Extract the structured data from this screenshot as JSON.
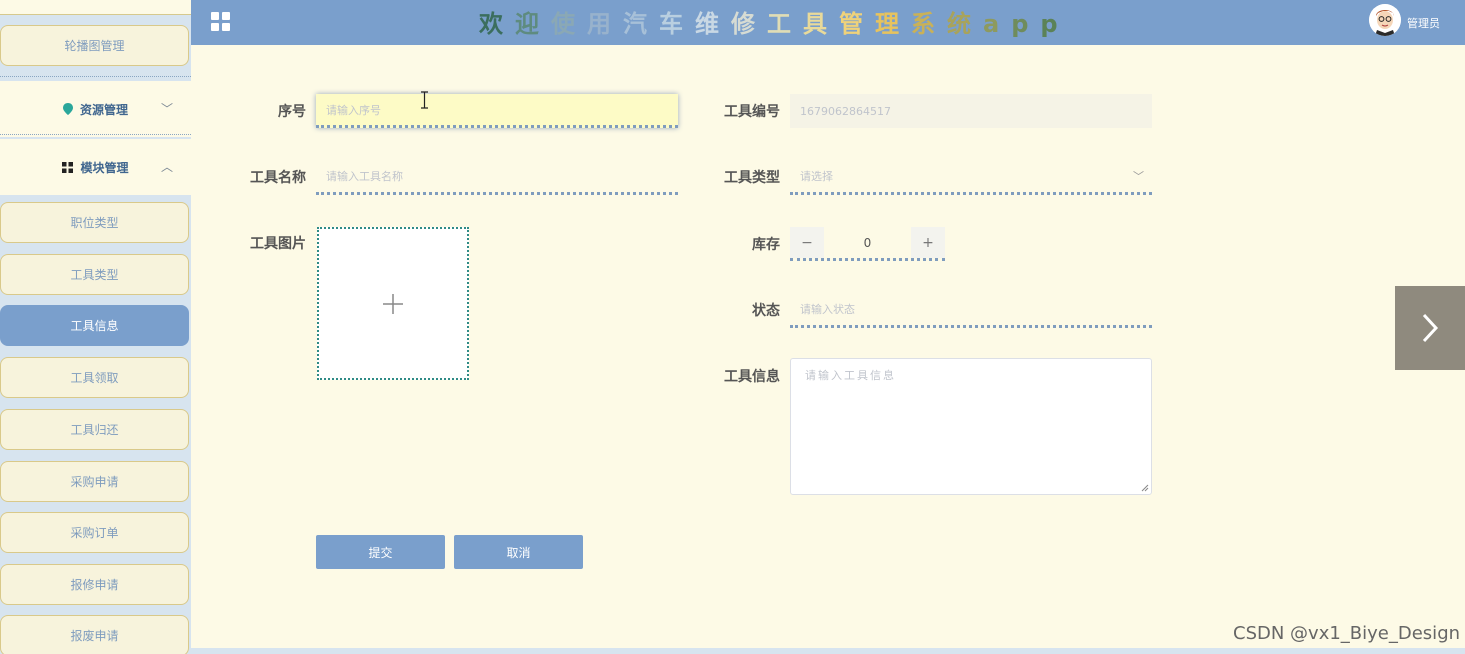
{
  "sidebar": {
    "carousel_label": "轮播图管理",
    "resource_menu": "资源管理",
    "module_menu": "模块管理",
    "items": [
      {
        "label": "职位类型"
      },
      {
        "label": "工具类型"
      },
      {
        "label": "工具信息"
      },
      {
        "label": "工具领取"
      },
      {
        "label": "工具归还"
      },
      {
        "label": "采购申请"
      },
      {
        "label": "采购订单"
      },
      {
        "label": "报修申请"
      },
      {
        "label": "报废申请"
      }
    ],
    "active_item": "工具信息"
  },
  "header": {
    "title_chars": [
      "欢",
      "迎",
      "使",
      "用",
      "汽",
      "车",
      "维",
      "修",
      "工",
      "具",
      "管",
      "理",
      "系",
      "统",
      "a",
      "p",
      "p"
    ],
    "user_label": "管理员",
    "bg_color": "#7a9fcc"
  },
  "form": {
    "seq_label": "序号",
    "seq_placeholder": "请输入序号",
    "tool_no_label": "工具编号",
    "tool_no_value": "1679062864517",
    "tool_name_label": "工具名称",
    "tool_name_placeholder": "请输入工具名称",
    "tool_type_label": "工具类型",
    "tool_type_placeholder": "请选择",
    "tool_image_label": "工具图片",
    "stock_label": "库存",
    "stock_value": "0",
    "status_label": "状态",
    "status_placeholder": "请输入状态",
    "tool_info_label": "工具信息",
    "tool_info_placeholder": "请输入工具信息",
    "submit_label": "提交",
    "cancel_label": "取消"
  },
  "watermark": "CSDN @vx1_Biye_Design"
}
